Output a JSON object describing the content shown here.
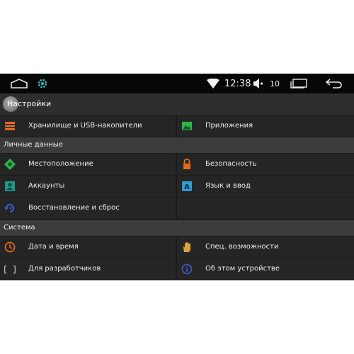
{
  "status_bar": {
    "icons": [
      "home-icon",
      "gear-icon",
      "wifi-icon",
      "volume-icon",
      "recent-apps-icon",
      "back-icon"
    ],
    "time": "12:38",
    "volume": "10"
  },
  "header": {
    "title": "Настройки"
  },
  "sections": [
    {
      "title": "",
      "items": [
        {
          "label": "Хранилище и USB-накопители",
          "icon": "storage-icon"
        },
        {
          "label": "Приложения",
          "icon": "apps-icon"
        }
      ]
    },
    {
      "title": "Личные данные",
      "items": [
        {
          "label": "Местоположение",
          "icon": "location-icon"
        },
        {
          "label": "Безопасность",
          "icon": "lock-icon"
        },
        {
          "label": "Аккаунты",
          "icon": "accounts-icon"
        },
        {
          "label": "Язык и ввод",
          "icon": "language-icon"
        },
        {
          "label": "Восстановление и сброс",
          "icon": "restore-icon"
        },
        {
          "label": "",
          "icon": ""
        }
      ]
    },
    {
      "title": "Система",
      "items": [
        {
          "label": "Дата и время",
          "icon": "clock-icon"
        },
        {
          "label": "Спец. возможности",
          "icon": "accessibility-hand-icon"
        },
        {
          "label": "Для разработчиков",
          "icon": "developer-braces-icon"
        },
        {
          "label": "Об этом устройстве",
          "icon": "info-icon"
        }
      ]
    }
  ],
  "colors": {
    "accent_orange": "#e06a1c",
    "green": "#2fb24c",
    "teal": "#1a9a8a",
    "blue": "#3b5fd4",
    "status_bar_bg": "#070707",
    "item_bg": "#252525",
    "section_bg": "#3b3b3b"
  }
}
